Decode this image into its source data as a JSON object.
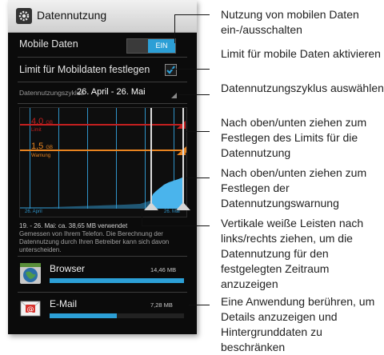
{
  "screen": {
    "title": "Datennutzung",
    "mobile_data_label": "Mobile Daten",
    "mobile_data_toggle": "EIN",
    "limit_label": "Limit für Mobildaten festlegen",
    "cycle_label": "Datennutzungszyklus",
    "cycle_value": "26. April - 26. Mai",
    "limit_value": "4,0",
    "limit_unit": "GB",
    "limit_text": "Limit",
    "warning_value": "1,5",
    "warning_unit": "GB",
    "warning_text": "Warnung",
    "axis_start": "26. April",
    "axis_end": "26. Mai",
    "usage_line": "19. - 26. Mai: ca. 38,65 MB verwendet",
    "usage_note": "Gemessen von Ihrem Telefon. Die Berechnung der Datennutzung durch Ihren Betreiber kann sich davon unterscheiden.",
    "apps": [
      {
        "name": "Browser",
        "size": "14,46 MB",
        "icon": "browser-icon",
        "usage_fraction": 1.0
      },
      {
        "name": "E-Mail",
        "size": "7,28 MB",
        "icon": "email-icon",
        "usage_fraction": 0.5
      }
    ]
  },
  "annotations": [
    "Nutzung von mobilen Daten ein-/ausschalten",
    "Limit für mobile Daten aktivieren",
    "Datennutzungszyklus auswählen",
    "Nach oben/unten ziehen zum Festlegen des Limits für die Datennutzung",
    "Nach oben/unten ziehen zum Festlegen der Datennutzungswarnung",
    "Vertikale weiße Leisten nach links/rechts ziehen, um die Datennutzung für den festgelegten Zeitraum anzuzeigen",
    "Eine Anwendung berühren, um Details anzuzeigen und Hintergrunddaten zu beschränken"
  ],
  "colors": {
    "accent": "#2c9fd6",
    "limit": "#c41f1f",
    "warning": "#e88420",
    "background": "#0b0b0b"
  }
}
